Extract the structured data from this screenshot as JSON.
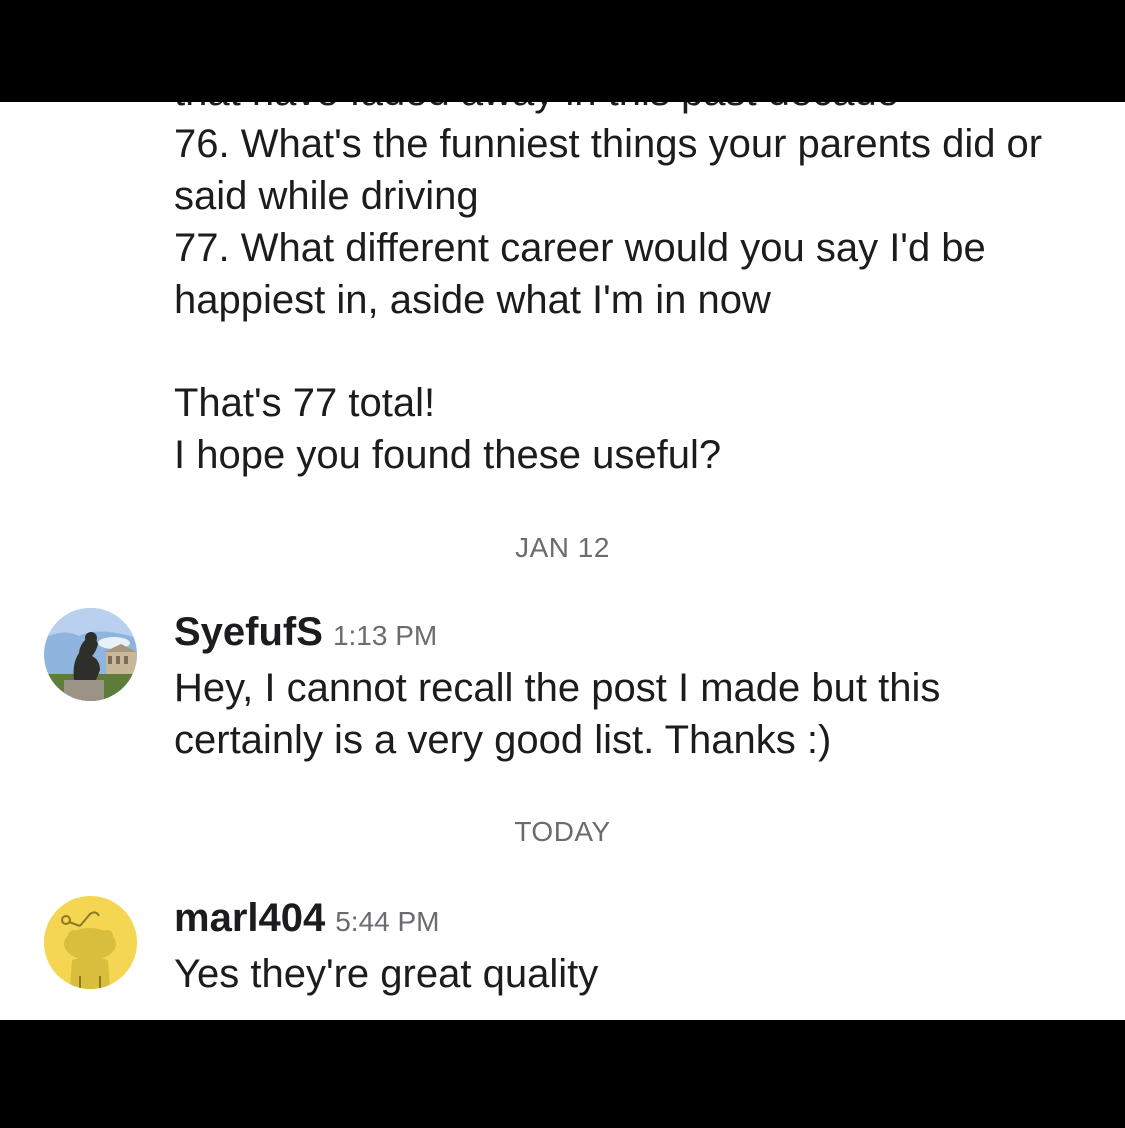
{
  "thread": {
    "clipped_line": "that have faded away in this past decade",
    "list_text": "76. What's the funniest things your parents did or said while driving\n77. What different career would you say I'd be happiest in, aside what I'm in now",
    "closing_text": "That's 77 total!\nI hope you found these useful?"
  },
  "separators": {
    "first": "JAN 12",
    "second": "TODAY"
  },
  "messages": [
    {
      "username": "SyefufS",
      "time": "1:13 PM",
      "text": "Hey, I cannot recall the post I made but this certainly is a very good list. Thanks :)",
      "avatar": "thinker-statue-avatar"
    },
    {
      "username": "marl404",
      "time": "5:44 PM",
      "text": "Yes they're great quality",
      "avatar": "snoo-avatar",
      "avatar_color": "#f5d652"
    }
  ]
}
